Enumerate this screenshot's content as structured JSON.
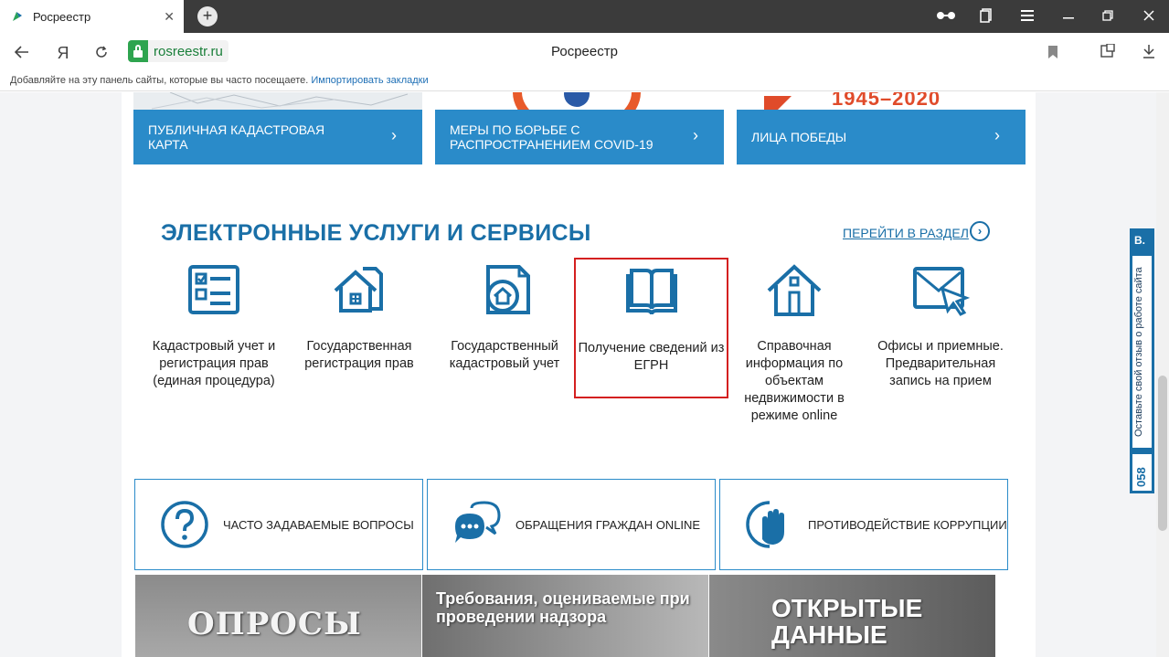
{
  "browser": {
    "tab_title": "Росреестр",
    "tab_close": "✕",
    "new_tab": "+",
    "domain": "rosreestr.ru",
    "page_title": "Росреестр",
    "yandex_btn": "Я",
    "bookmarks_hint": "Добавляйте на эту панель сайты, которые вы часто посещаете.",
    "bookmarks_import": "Импортировать закладки"
  },
  "promos": [
    {
      "label": "ПУБЛИЧНАЯ КАДАСТРОВАЯ КАРТА"
    },
    {
      "label": "МЕРЫ ПО БОРЬБЕ С РАСПРОСТРАНЕНИЕМ COVID-19"
    },
    {
      "label": "ЛИЦА ПОБЕДЫ"
    }
  ],
  "promo_year": "1945–2020",
  "section": {
    "title": "ЭЛЕКТРОННЫЕ УСЛУГИ И СЕРВИСЫ",
    "link": "ПЕРЕЙТИ В РАЗДЕЛ"
  },
  "services": [
    {
      "label": "Кадастровый учет и регистрация прав (единая процедура)",
      "icon": "form-checklist-icon"
    },
    {
      "label": "Государственная регистрация прав",
      "icon": "house-documents-icon"
    },
    {
      "label": "Государственный кадастровый учет",
      "icon": "house-document-icon"
    },
    {
      "label": "Получение сведений из ЕГРН",
      "icon": "open-book-icon"
    },
    {
      "label": "Справочная информация по объектам недвижимости в режиме online",
      "icon": "house-icon"
    },
    {
      "label": "Офисы и приемные. Предварительная запись на прием",
      "icon": "envelope-cursor-icon"
    }
  ],
  "features": [
    {
      "label": "ЧАСТО ЗАДАВАЕМЫЕ ВОПРОСЫ",
      "icon": "question-circle-icon"
    },
    {
      "label": "ОБРАЩЕНИЯ ГРАЖДАН ONLINE",
      "icon": "chat-bubbles-icon"
    },
    {
      "label": "ПРОТИВОДЕЙСТВИЕ КОРРУПЦИИ",
      "icon": "stop-hand-icon"
    }
  ],
  "banners": [
    {
      "text": "ОПРОСЫ"
    },
    {
      "text": "Требования, оцениваемые при проведении надзора"
    },
    {
      "text": "ОТКРЫТЫЕ ДАННЫЕ"
    }
  ],
  "feedback": {
    "text": "Оставьте свой отзыв о работе сайта",
    "number": "058",
    "top": "В."
  },
  "colors": {
    "accent": "#2a8bc9",
    "title": "#1a6fa7",
    "highlight": "#d42020",
    "secure": "#2ea44f"
  }
}
